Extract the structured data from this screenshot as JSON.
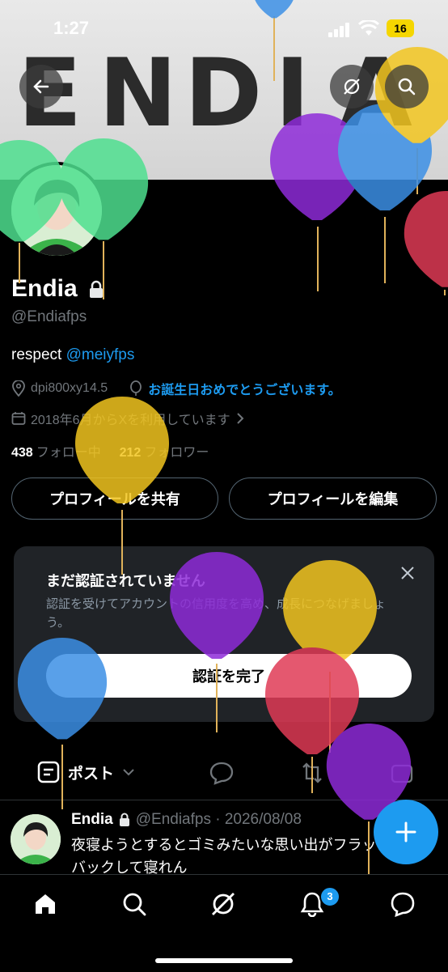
{
  "status_bar": {
    "time": "1:27",
    "battery": "16"
  },
  "banner": {
    "letters": [
      "E",
      "N",
      "D",
      "I",
      "A"
    ]
  },
  "profile": {
    "display_name": "Endia",
    "handle": "@Endiafps",
    "bio_text": "respect ",
    "bio_mention": "@meiyfps",
    "location": "dpi800xy14.5",
    "birthday_message": "お誕生日おめでとうございます。",
    "joined": "2018年6月からXを利用しています",
    "following_count": "438",
    "following_label": "フォロー中",
    "followers_count": "212",
    "followers_label": "フォロワー"
  },
  "buttons": {
    "share_profile": "プロフィールを共有",
    "edit_profile": "プロフィールを編集"
  },
  "verify_card": {
    "title": "まだ認証されていません",
    "description": "認証を受けてアカウントの信用度を高め、成長につなげましょう。",
    "button": "認証を完了"
  },
  "tabs": {
    "posts": "ポスト"
  },
  "post": {
    "author": "Endia",
    "handle_date": "@Endiafps · 2026/08/08",
    "text": "夜寝ようとするとゴミみたいな思い出がフラッシュバックして寝れん"
  },
  "nav": {
    "notification_badge": "3"
  },
  "colors": {
    "accent": "#1d9bf0",
    "balloon_purple": "#8e2bd8",
    "balloon_blue": "#3b8fe6",
    "balloon_yellow": "#f2c61f",
    "balloon_green": "#4ee08f",
    "balloon_red": "#e03a55"
  }
}
